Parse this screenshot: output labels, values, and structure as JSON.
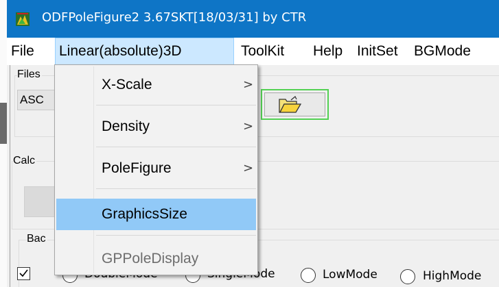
{
  "window": {
    "title": "ODFPoleFigure2 3.67SKT[18/03/31] by CTR",
    "app_icon": "app-logo-icon"
  },
  "menubar": {
    "items": [
      {
        "label": "File"
      },
      {
        "label": "Linear(absolute)3D",
        "active": true
      },
      {
        "label": "ToolKit"
      },
      {
        "label": "Help"
      },
      {
        "label": "InitSet"
      },
      {
        "label": "BGMode"
      }
    ]
  },
  "dropdown": {
    "items": [
      {
        "label": "X-Scale",
        "submenu": true,
        "submenu_arrow": ">"
      },
      {
        "label": "Density",
        "submenu": true,
        "submenu_arrow": ">"
      },
      {
        "label": "PoleFigure",
        "submenu": true,
        "submenu_arrow": ">"
      },
      {
        "label": "GraphicsSize",
        "highlighted": true
      },
      {
        "label": "GPPoleDisplay",
        "disabled": true
      }
    ]
  },
  "client": {
    "files_group_label": "Files",
    "files_combo_value": "ASC",
    "folder_button_icon": "folder-open-icon",
    "calc_group_label": "Calc",
    "background_group_label": "Bac",
    "modes": {
      "checkbox_checked": true,
      "double_label": "DoubleMode",
      "single_label": "SingleMode",
      "low_label": "LowMode",
      "high_label": "HighMode"
    }
  },
  "colors": {
    "titlebar": "#0e75c6",
    "menu_active_bg": "#cce8ff",
    "dropdown_highlight": "#91c9f7",
    "folder_button_border": "#53d153"
  }
}
